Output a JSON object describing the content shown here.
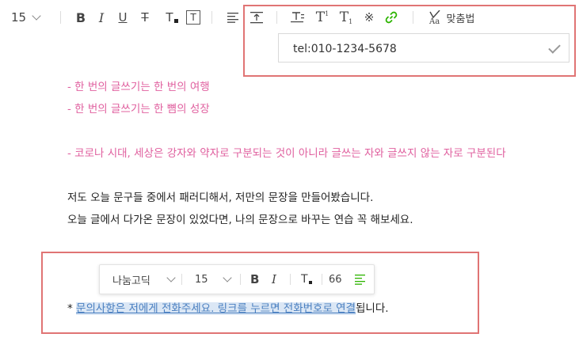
{
  "toolbar": {
    "font_size": "15",
    "bold": "B",
    "italic": "I",
    "underline": "U",
    "strike": "T",
    "text_color": "T",
    "text_bg": "T",
    "superscript": "T",
    "superscript_mark": "1",
    "subscript": "T",
    "subscript_mark": "1",
    "special_char": "※",
    "spellcheck_label": "맞춤법"
  },
  "link_popup": {
    "value": "tel:010-1234-5678"
  },
  "content": {
    "line1": "- 한 번의 글쓰기는 한 번의 여행",
    "line2": "- 한 번의 글쓰기는 한 뼘의 성장",
    "line3": "- 코로나 시대, 세상은 강자와 약자로 구분되는 것이 아니라 글쓰는 자와 글쓰지 않는 자로 구분된다",
    "line4": "저도 오늘 문구들 중에서 패러디해서, 저만의 문장을 만들어봤습니다.",
    "line5": "오늘 글에서 다가온 문장이 있었다면, 나의 문장으로 바꾸는 연습 꼭 해보세요.",
    "bullet": "*",
    "selected_text": "문의사항은 저에게 전화주세요. 링크를 누르면 전화번호로 연결",
    "after_text": "됩니다."
  },
  "floating_toolbar": {
    "font": "나눔고딕",
    "size": "15",
    "bold": "B",
    "italic": "I",
    "text_color": "T",
    "quote": "66"
  },
  "colors": {
    "pink_text": "#e0609f",
    "highlight_border": "#e07474",
    "link_green": "#2db400",
    "selection_bg": "#dbe7f5"
  }
}
